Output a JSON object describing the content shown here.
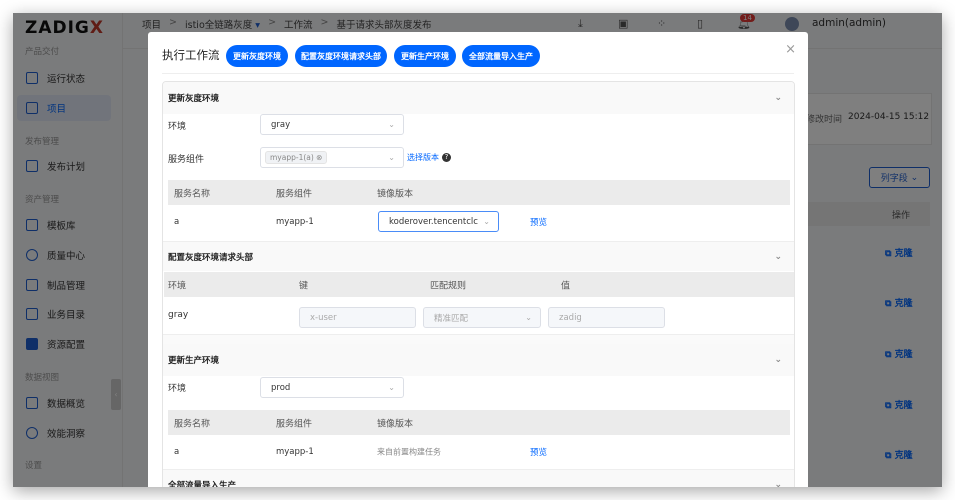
{
  "app": {
    "logo": "ZADIGX",
    "user": "admin(admin)",
    "notifications": "14"
  },
  "sidebar": {
    "groups": [
      "产品交付",
      "发布管理",
      "资产管理",
      "数据视图",
      "设置"
    ],
    "items": [
      "运行状态",
      "项目",
      "发布计划",
      "模板库",
      "质量中心",
      "制品管理",
      "业务目录",
      "资源配置",
      "数据概览",
      "效能洞察"
    ]
  },
  "breadcrumb": [
    "项目",
    "istio全链路灰度",
    "工作流",
    "基于请求头部灰度发布"
  ],
  "background": {
    "modified_label": "修改时间",
    "modified_value": "2024-04-15 15:12",
    "columns_button": "列字段",
    "action_header": "操作",
    "clone_label": "克隆"
  },
  "modal": {
    "title": "执行工作流",
    "tabs": [
      "更新灰度环境",
      "配置灰度环境请求头部",
      "更新生产环境",
      "全部流量导入生产"
    ],
    "close": "×",
    "sec1": {
      "title": "更新灰度环境",
      "env_label": "环境",
      "env_value": "gray",
      "svc_label": "服务组件",
      "svc_tag": "myapp-1(a)",
      "choose_version": "选择版本",
      "headers": [
        "服务名称",
        "服务组件",
        "镜像版本"
      ],
      "row": {
        "name": "a",
        "component": "myapp-1",
        "image": "koderover.tencentclc",
        "preview": "预览"
      }
    },
    "sec2": {
      "title": "配置灰度环境请求头部",
      "headers": [
        "环境",
        "键",
        "匹配规则",
        "值"
      ],
      "row": {
        "env": "gray",
        "key": "x-user",
        "rule": "精准匹配",
        "value": "zadig"
      }
    },
    "sec3": {
      "title": "更新生产环境",
      "env_label": "环境",
      "env_value": "prod",
      "headers": [
        "服务名称",
        "服务组件",
        "镜像版本"
      ],
      "row": {
        "name": "a",
        "component": "myapp-1",
        "image": "来自前置构建任务",
        "preview": "预览"
      }
    },
    "sec4": {
      "title": "全部流量导入生产"
    }
  },
  "colors": {
    "accent": "#0066ff"
  }
}
